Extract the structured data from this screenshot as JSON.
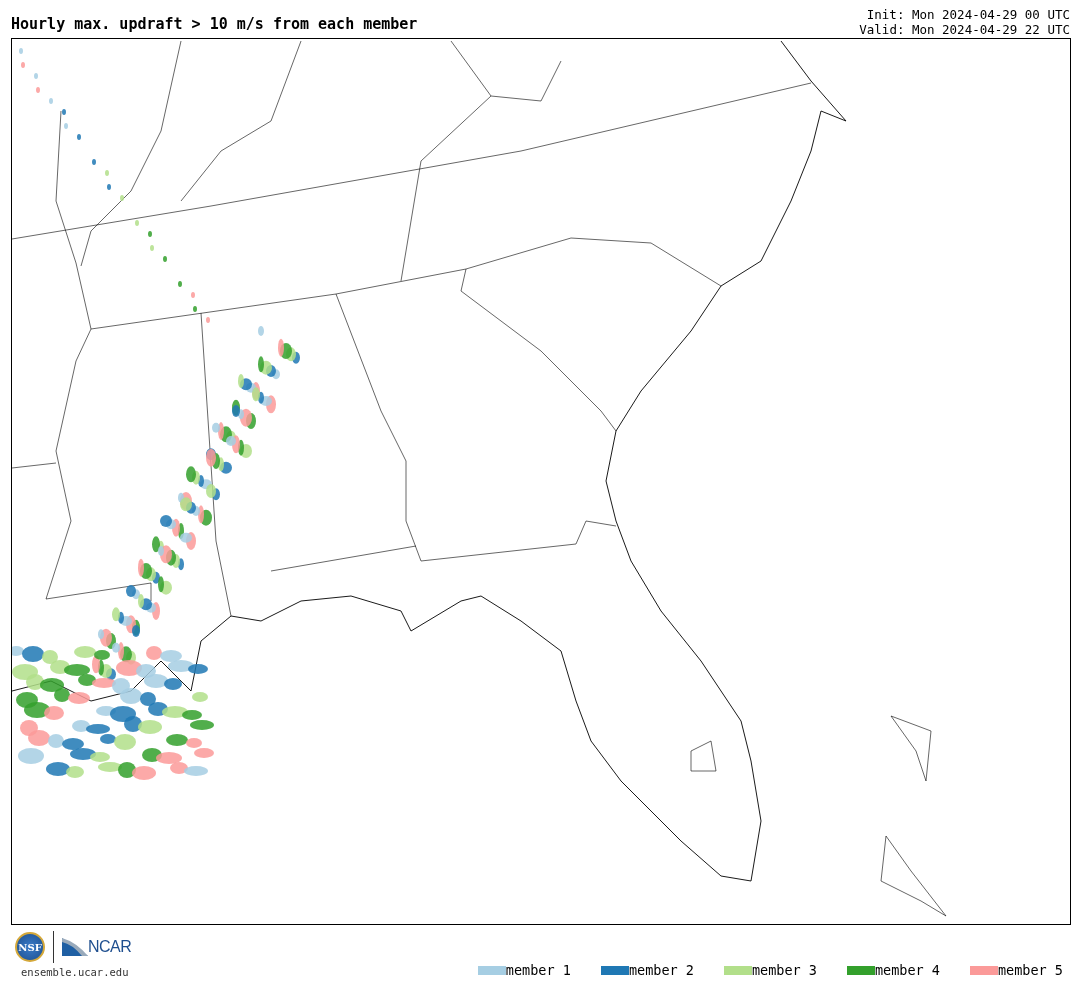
{
  "title": "Hourly max. updraft > 10 m/s from each member",
  "init": "Init: Mon 2024-04-29 00 UTC",
  "valid": "Valid: Mon 2024-04-29 22 UTC",
  "logos": {
    "nsf": "NSF",
    "ncar": "NCAR"
  },
  "site": "ensemble.ucar.edu",
  "legend": [
    {
      "label": "member 1",
      "color": "#a6cee3"
    },
    {
      "label": "member 2",
      "color": "#1f78b4"
    },
    {
      "label": "member 3",
      "color": "#b2df8a"
    },
    {
      "label": "member 4",
      "color": "#33a02c"
    },
    {
      "label": "member 5",
      "color": "#fb9a99"
    }
  ]
}
